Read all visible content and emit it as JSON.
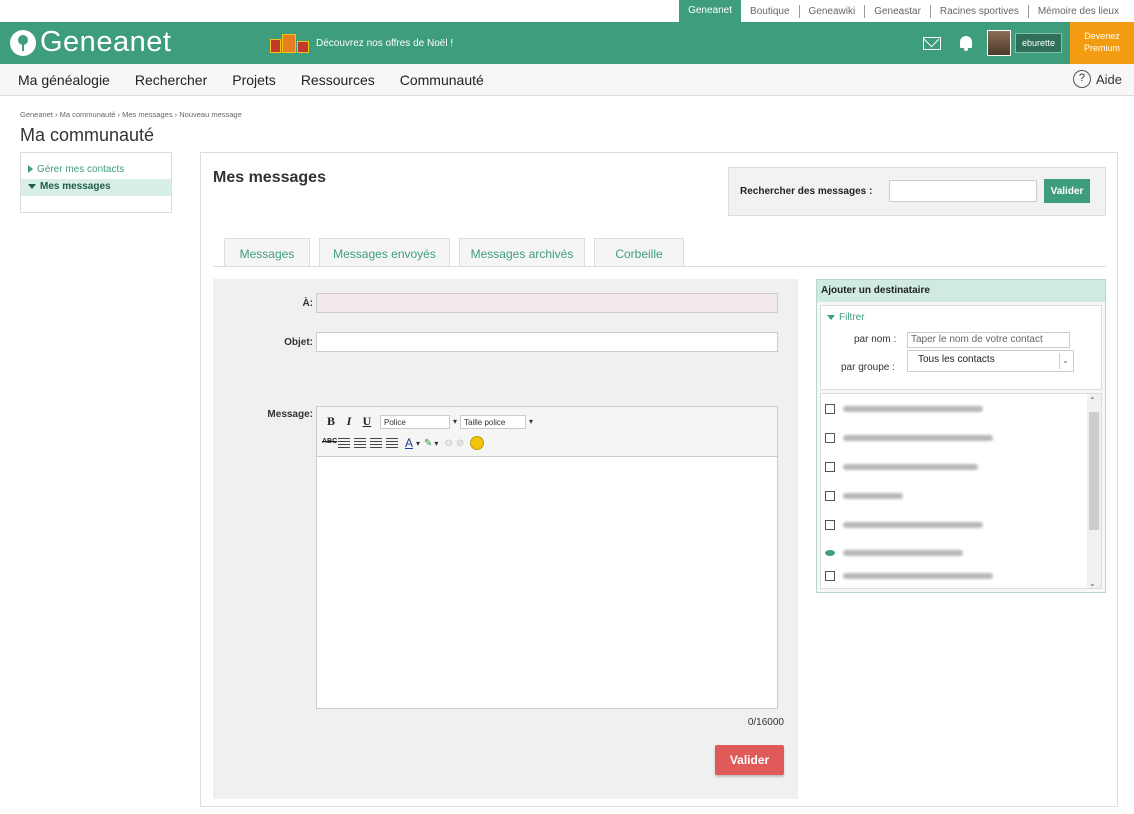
{
  "toplinks": [
    "Geneanet",
    "Boutique",
    "Geneawiki",
    "Geneastar",
    "Racines sportives",
    "Mémoire des lieux"
  ],
  "header": {
    "logo_text": "Geneanet",
    "promo_text": "Découvrez nos offres de Noël !",
    "username": "eburette",
    "premium_line1": "Devenez",
    "premium_line2": "Premium"
  },
  "nav": {
    "items": [
      "Ma généalogie",
      "Rechercher",
      "Projets",
      "Ressources",
      "Communauté"
    ],
    "help": "Aide"
  },
  "breadcrumb": "Geneanet › Ma communauté › Mes messages › Nouveau message",
  "page_title": "Ma communauté",
  "sidebar": {
    "items": [
      "Gérer mes contacts",
      "Mes messages"
    ]
  },
  "main": {
    "title": "Mes messages",
    "search_label": "Rechercher des messages :",
    "search_value": "",
    "search_button": "Valider",
    "tabs": [
      "Messages",
      "Messages envoyés",
      "Messages archivés",
      "Corbeille"
    ]
  },
  "form": {
    "to_label": "À:",
    "subject_label": "Objet:",
    "message_label": "Message:",
    "font_select": "Police",
    "size_select": "Taille police",
    "counter": "0/16000",
    "submit": "Valider"
  },
  "recipient": {
    "title": "Ajouter un destinataire",
    "filter_title": "Filtrer",
    "by_name_label": "par nom :",
    "by_name_placeholder": "Taper le nom de votre contact",
    "by_group_label": "par groupe :",
    "group_value": "Tous les contacts"
  },
  "colors": {
    "brand_green": "#3e9d7d",
    "premium_orange": "#f39c12",
    "submit_red": "#e05a5a"
  }
}
